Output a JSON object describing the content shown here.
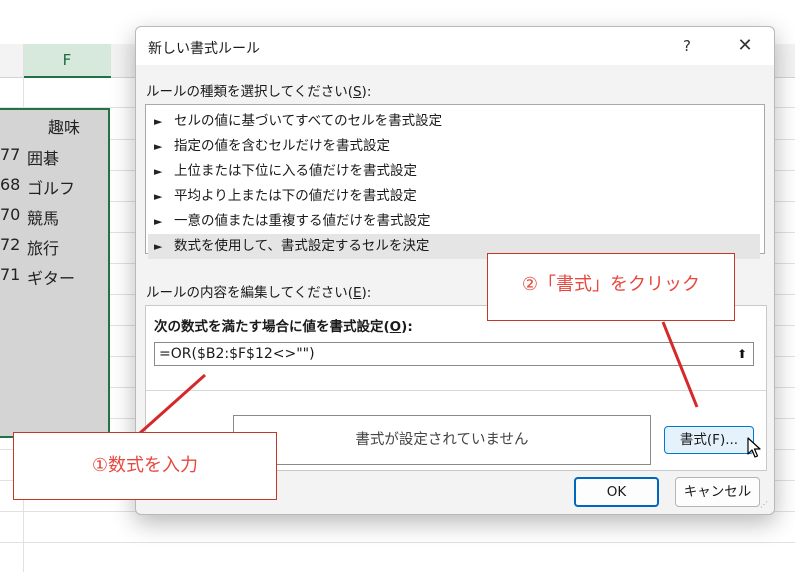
{
  "sheet": {
    "column_f_header": "F",
    "column_f_title": "趣味",
    "rows": [
      {
        "prev_digits": "77",
        "hobby": "囲碁"
      },
      {
        "prev_digits": "68",
        "hobby": "ゴルフ"
      },
      {
        "prev_digits": "70",
        "hobby": "競馬"
      },
      {
        "prev_digits": "72",
        "hobby": "旅行"
      },
      {
        "prev_digits": "71",
        "hobby": "ギター"
      }
    ]
  },
  "dialog": {
    "title": "新しい書式ルール",
    "help": "?",
    "close": "✕",
    "rule_type_label": "ルールの種類を選択してください(",
    "rule_type_key": "S",
    "rule_type_suffix": "):",
    "rule_arrow": "►",
    "rule_types": [
      "セルの値に基づいてすべてのセルを書式設定",
      "指定の値を含むセルだけを書式設定",
      "上位または下位に入る値だけを書式設定",
      "平均より上または下の値だけを書式設定",
      "一意の値または重複する値だけを書式設定",
      "数式を使用して、書式設定するセルを決定"
    ],
    "selected_rule_index": 5,
    "edit_label": "ルールの内容を編集してください(",
    "edit_key": "E",
    "edit_suffix": "):",
    "formula_label": "次の数式を満たす場合に値を書式設定(",
    "formula_key": "O",
    "formula_suffix": "):",
    "formula_value": "=OR($B2:$F$12<>\"\")",
    "collapse_icon": "⬆",
    "preview_text": "書式が設定されていません",
    "format_button": "書式(F)...",
    "ok_button": "OK",
    "cancel_button": "キャンセル"
  },
  "annotations": {
    "step1": "①数式を入力",
    "step2": "②「書式」をクリック",
    "color": "#e8473e",
    "line_color": "#d62828"
  }
}
